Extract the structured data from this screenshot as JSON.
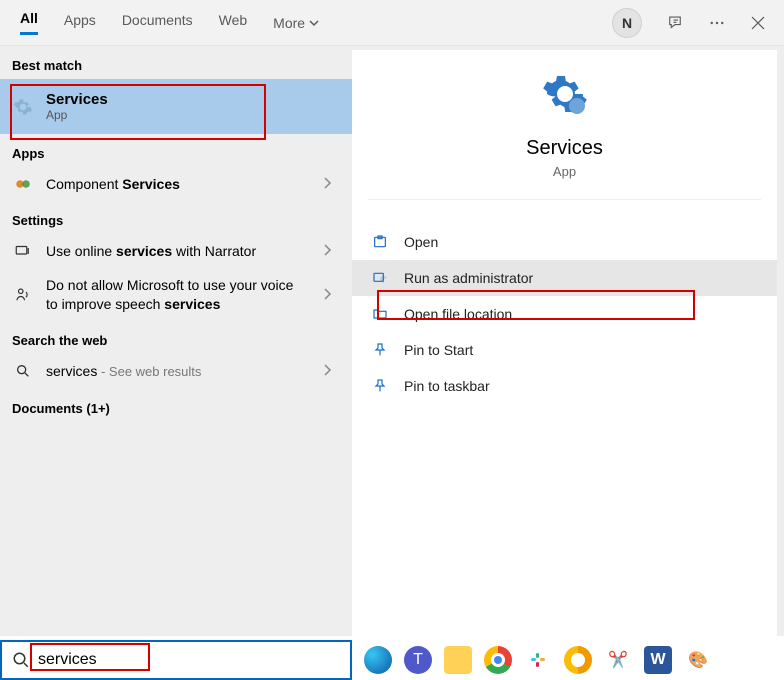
{
  "tabs": {
    "all": "All",
    "apps": "Apps",
    "docs": "Documents",
    "web": "Web",
    "more": "More"
  },
  "avatar_initial": "N",
  "sections": {
    "best_match": "Best match",
    "apps": "Apps",
    "settings": "Settings",
    "web": "Search the web",
    "documents": "Documents (1+)"
  },
  "best": {
    "title": "Services",
    "subtitle": "App"
  },
  "app_result": {
    "prefix": "Component ",
    "bold": "Services"
  },
  "setting1": {
    "p1": "Use online ",
    "b": "services",
    "p2": " with Narrator"
  },
  "setting2": {
    "p1": "Do not allow Microsoft to use your voice to improve speech ",
    "b": "services"
  },
  "web_result": {
    "term": "services",
    "extra": " - See web results"
  },
  "preview": {
    "title": "Services",
    "subtitle": "App"
  },
  "actions": {
    "open": "Open",
    "run_admin": "Run as administrator",
    "open_loc": "Open file location",
    "pin_start": "Pin to Start",
    "pin_taskbar": "Pin to taskbar"
  },
  "search_value": "services"
}
